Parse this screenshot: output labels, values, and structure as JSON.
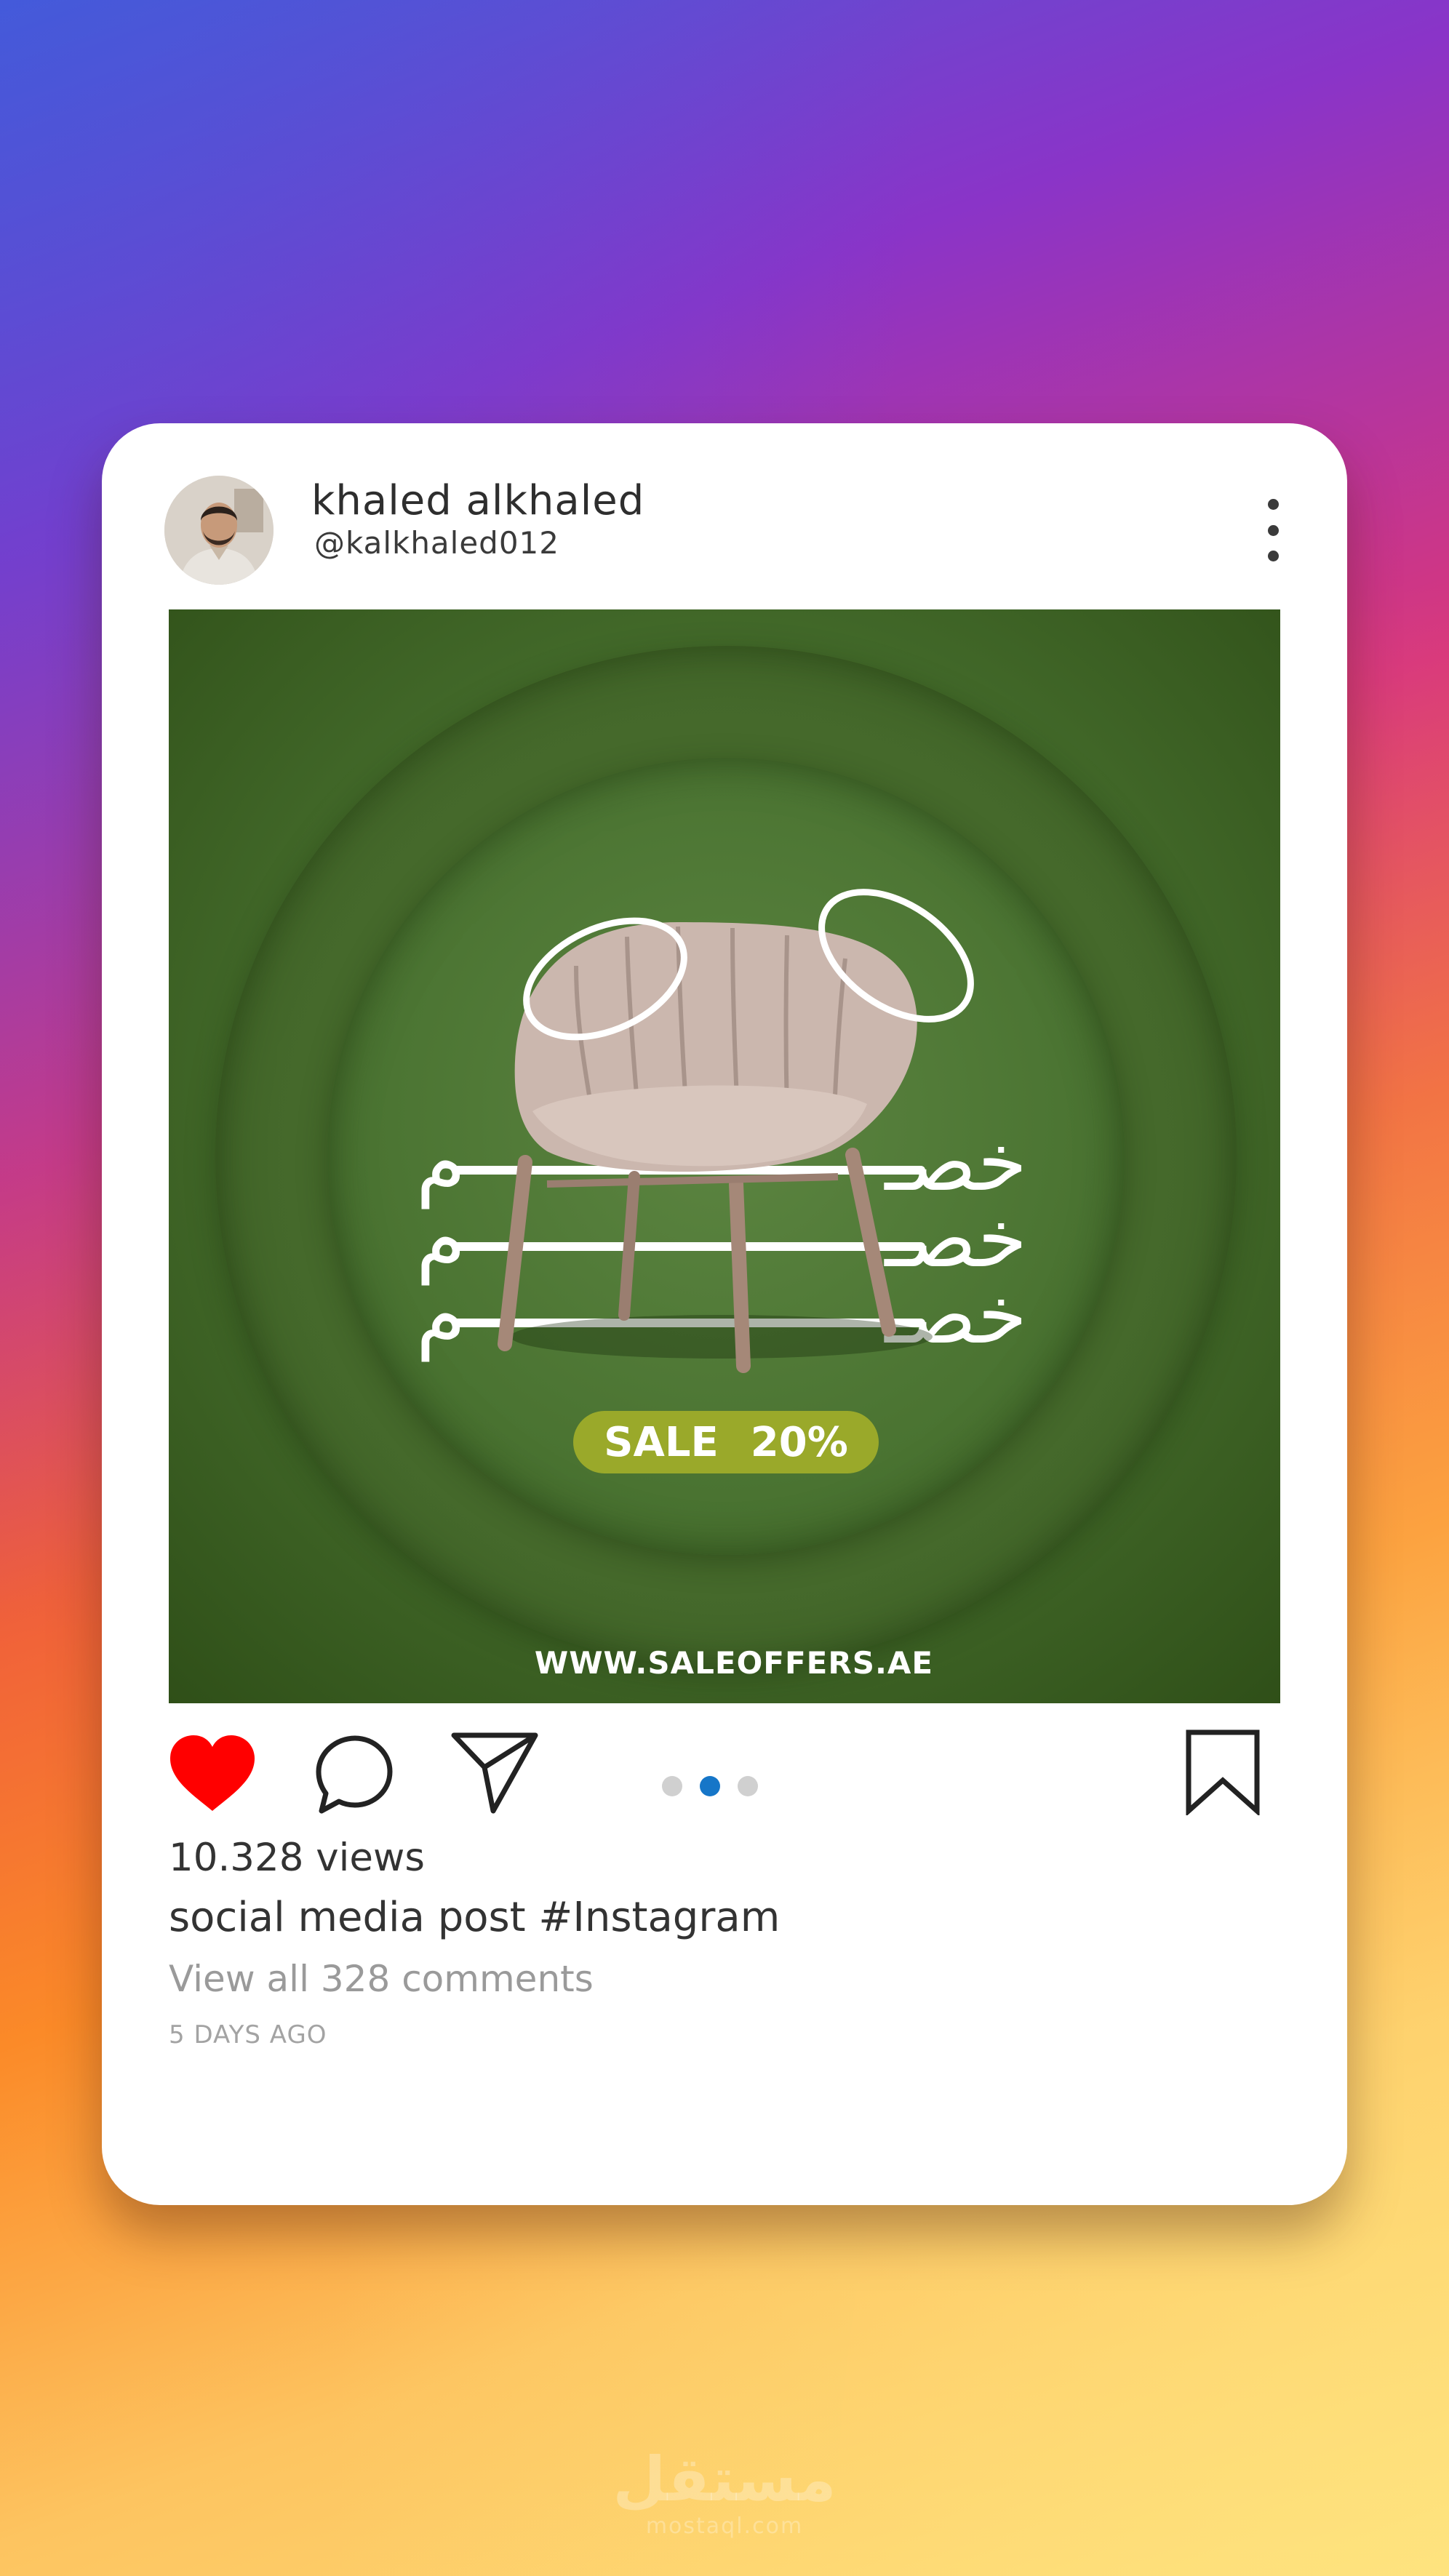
{
  "post": {
    "user_name": "khaled alkhaled",
    "user_handle": "@kalkhaled012",
    "image": {
      "arabic_left": "م",
      "arabic_right": "خصـ",
      "sale_word": "SALE",
      "sale_percent": "20%",
      "website": "WWW.SALEOFFERS.AE"
    },
    "carousel": {
      "total": 3,
      "active": 2
    },
    "views": "10.328 views",
    "caption": "social media post #Instagram",
    "comments_link": "View all 328 comments",
    "posted": "5 DAYS AGO",
    "liked": true
  },
  "icons": {
    "more": "more-vertical-icon",
    "like": "heart-icon",
    "comment": "comment-icon",
    "share": "send-icon",
    "save": "bookmark-icon"
  },
  "colors": {
    "like": "#ff0000",
    "active_dot": "#1676c8",
    "inactive_dot": "#d0d0d0",
    "post_background": "#436a2a",
    "sale_pill": "#9aa92a"
  },
  "watermark": {
    "logo": "مستقل",
    "domain": "mostaql.com"
  }
}
